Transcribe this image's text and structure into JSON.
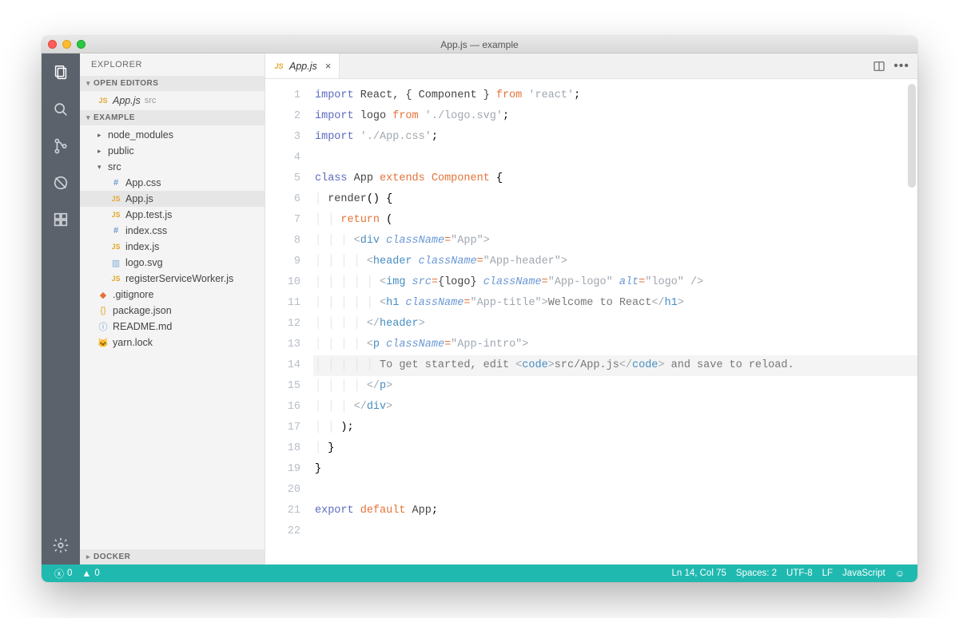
{
  "window": {
    "title": "App.js — example"
  },
  "activity": {
    "items": [
      {
        "name": "explorer",
        "active": true
      },
      {
        "name": "search",
        "active": false
      },
      {
        "name": "scm",
        "active": false
      },
      {
        "name": "debug",
        "active": false
      },
      {
        "name": "extensions",
        "active": false
      }
    ],
    "bottom": [
      {
        "name": "settings"
      }
    ]
  },
  "sidebar": {
    "title": "EXPLORER",
    "sections": {
      "openEditors": {
        "label": "OPEN EDITORS",
        "items": [
          {
            "icon": "js",
            "name": "App.js",
            "hint": "src"
          }
        ]
      },
      "workspace": {
        "label": "EXAMPLE",
        "tree": [
          {
            "type": "folder",
            "expanded": false,
            "depth": 1,
            "name": "node_modules"
          },
          {
            "type": "folder",
            "expanded": false,
            "depth": 1,
            "name": "public"
          },
          {
            "type": "folder",
            "expanded": true,
            "depth": 1,
            "name": "src"
          },
          {
            "type": "file",
            "icon": "css",
            "depth": 2,
            "name": "App.css"
          },
          {
            "type": "file",
            "icon": "js",
            "depth": 2,
            "name": "App.js",
            "selected": true
          },
          {
            "type": "file",
            "icon": "js",
            "depth": 2,
            "name": "App.test.js"
          },
          {
            "type": "file",
            "icon": "css",
            "depth": 2,
            "name": "index.css"
          },
          {
            "type": "file",
            "icon": "js",
            "depth": 2,
            "name": "index.js"
          },
          {
            "type": "file",
            "icon": "svg",
            "depth": 2,
            "name": "logo.svg"
          },
          {
            "type": "file",
            "icon": "js",
            "depth": 2,
            "name": "registerServiceWorker.js"
          },
          {
            "type": "file",
            "icon": "git",
            "depth": 1,
            "name": ".gitignore"
          },
          {
            "type": "file",
            "icon": "json",
            "depth": 1,
            "name": "package.json"
          },
          {
            "type": "file",
            "icon": "info",
            "depth": 1,
            "name": "README.md"
          },
          {
            "type": "file",
            "icon": "yarn",
            "depth": 1,
            "name": "yarn.lock"
          }
        ]
      },
      "docker": {
        "label": "DOCKER"
      }
    }
  },
  "tabs": {
    "items": [
      {
        "icon": "js",
        "label": "App.js",
        "preview": true
      }
    ],
    "close_label": "×"
  },
  "editor": {
    "cursor_line": 14,
    "lines": [
      "<span class='kw'>import</span> <span class='nm'>React, { Component }</span> <span class='kw2'>from</span> <span class='str'>'react'</span>;",
      "<span class='kw'>import</span> <span class='nm'>logo</span> <span class='kw2'>from</span> <span class='str'>'./logo.svg'</span>;",
      "<span class='kw'>import</span> <span class='str'>'./App.css'</span>;",
      "",
      "<span class='kw'>class</span> <span class='nm'>App</span> <span class='kw2'>extends</span> <span class='nm' style='color:#e57339'>Component</span> {",
      "<span class='indent-guide'>│ </span><span class='nm'>render</span>() {",
      "<span class='indent-guide'>│ │ </span><span class='kw2'>return</span> (",
      "<span class='indent-guide'>│ │ │ </span><span class='tagp'>&lt;</span><span class='tag'>div</span> <span class='attr'>className</span><span class='op'>=</span><span class='val'>\"App\"</span><span class='tagp'>&gt;</span>",
      "<span class='indent-guide'>│ │ │ │ </span><span class='tagp'>&lt;</span><span class='tag'>header</span> <span class='attr'>className</span><span class='op'>=</span><span class='val'>\"App-header\"</span><span class='tagp'>&gt;</span>",
      "<span class='indent-guide'>│ │ │ │ │ </span><span class='tagp'>&lt;</span><span class='tag'>img</span> <span class='attr'>src</span><span class='op'>=</span><span class='brace-expr'>{logo}</span> <span class='attr'>className</span><span class='op'>=</span><span class='val'>\"App-logo\"</span> <span class='attr'>alt</span><span class='op'>=</span><span class='val'>\"logo\"</span> <span class='tagp'>/&gt;</span>",
      "<span class='indent-guide'>│ │ │ │ │ </span><span class='tagp'>&lt;</span><span class='tag'>h1</span> <span class='attr'>className</span><span class='op'>=</span><span class='val'>\"App-title\"</span><span class='tagp'>&gt;</span><span class='txt'>Welcome to React</span><span class='tagp'>&lt;/</span><span class='tag'>h1</span><span class='tagp'>&gt;</span>",
      "<span class='indent-guide'>│ │ │ │ </span><span class='tagp'>&lt;/</span><span class='tag'>header</span><span class='tagp'>&gt;</span>",
      "<span class='indent-guide'>│ │ │ │ </span><span class='tagp'>&lt;</span><span class='tag'>p</span> <span class='attr'>className</span><span class='op'>=</span><span class='val'>\"App-intro\"</span><span class='tagp'>&gt;</span>",
      "<span class='indent-guide'>│ │ │ │ │ </span><span class='txt'>To get started, edit </span><span class='tagp'>&lt;</span><span class='tag'>code</span><span class='tagp'>&gt;</span><span class='txt'>src/App.js</span><span class='tagp'>&lt;/</span><span class='tag'>code</span><span class='tagp'>&gt;</span><span class='txt'> and save to reload.</span>",
      "<span class='indent-guide'>│ │ │ │ </span><span class='tagp'>&lt;/</span><span class='tag'>p</span><span class='tagp'>&gt;</span>",
      "<span class='indent-guide'>│ │ │ </span><span class='tagp'>&lt;/</span><span class='tag'>div</span><span class='tagp'>&gt;</span>",
      "<span class='indent-guide'>│ │ </span>);",
      "<span class='indent-guide'>│ </span>}",
      "}",
      "",
      "<span class='kw'>export</span> <span class='kw2'>default</span> <span class='nm'>App</span>;",
      ""
    ]
  },
  "status": {
    "errors": "0",
    "warnings": "0",
    "position": "Ln 14, Col 75",
    "spaces": "Spaces: 2",
    "encoding": "UTF-8",
    "eol": "LF",
    "language": "JavaScript"
  }
}
